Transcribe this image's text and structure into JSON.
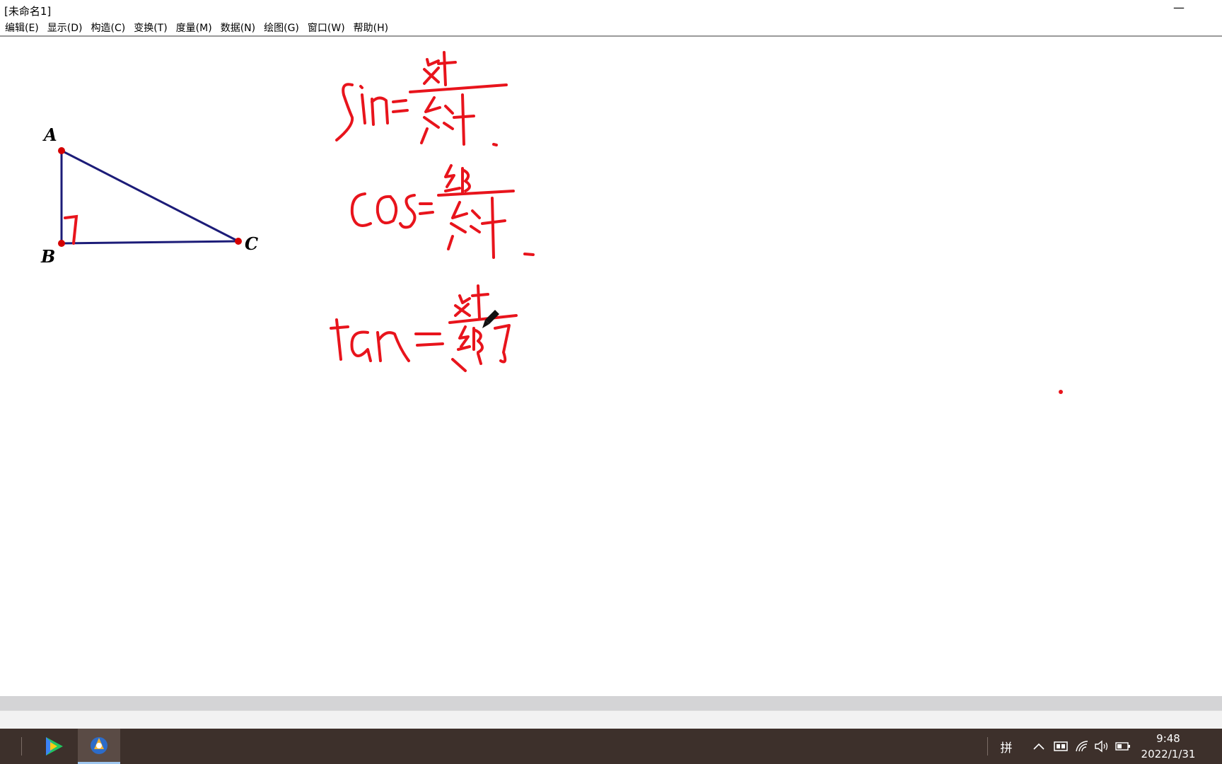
{
  "window": {
    "title": "[未命名1]",
    "minimize_glyph": "—"
  },
  "menu": {
    "items": [
      {
        "label": "编辑(E)",
        "name": "menu-edit"
      },
      {
        "label": "显示(D)",
        "name": "menu-display"
      },
      {
        "label": "构造(C)",
        "name": "menu-construct"
      },
      {
        "label": "变换(T)",
        "name": "menu-transform"
      },
      {
        "label": "度量(M)",
        "name": "menu-measure"
      },
      {
        "label": "数据(N)",
        "name": "menu-data"
      },
      {
        "label": "绘图(G)",
        "name": "menu-graph"
      },
      {
        "label": "窗口(W)",
        "name": "menu-window"
      },
      {
        "label": "帮助(H)",
        "name": "menu-help"
      }
    ]
  },
  "figure": {
    "labels": {
      "a": "A",
      "b": "B",
      "c": "C"
    },
    "colors": {
      "segment": "#1c1c78",
      "point": "#d40000",
      "ink": "#e8141c"
    }
  },
  "taskbar": {
    "ime": "拼",
    "time": "9:48",
    "date": "2022/1/31",
    "icons": [
      "player-icon",
      "sketchpad-icon",
      "chevron-up-icon",
      "ime-mode-icon",
      "wifi-icon",
      "volume-icon",
      "battery-icon"
    ]
  }
}
